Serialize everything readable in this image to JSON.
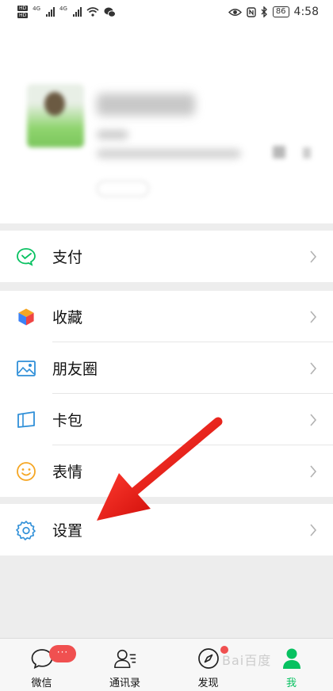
{
  "status_bar": {
    "hd_labels": [
      "HD",
      "HD"
    ],
    "network_labels": [
      "4G",
      "4G"
    ],
    "battery": "86",
    "time": "4:58"
  },
  "menu": {
    "pay": {
      "label": "支付",
      "icon": "pay-icon"
    },
    "favorites": {
      "label": "收藏",
      "icon": "cube-icon"
    },
    "moments": {
      "label": "朋友圈",
      "icon": "image-icon"
    },
    "cards": {
      "label": "卡包",
      "icon": "card-icon"
    },
    "stickers": {
      "label": "表情",
      "icon": "smiley-icon"
    },
    "settings": {
      "label": "设置",
      "icon": "gear-icon"
    }
  },
  "tabbar": {
    "tabs": [
      {
        "label": "微信",
        "icon": "chat-icon",
        "badge": "···"
      },
      {
        "label": "通讯录",
        "icon": "contacts-icon"
      },
      {
        "label": "发现",
        "icon": "compass-icon",
        "dot": true
      },
      {
        "label": "我",
        "icon": "person-icon",
        "active": true
      }
    ]
  },
  "watermark": "Bai百度",
  "colors": {
    "accent_green": "#07c160",
    "badge_red": "#f05050",
    "arrow_red": "#e8140f"
  }
}
